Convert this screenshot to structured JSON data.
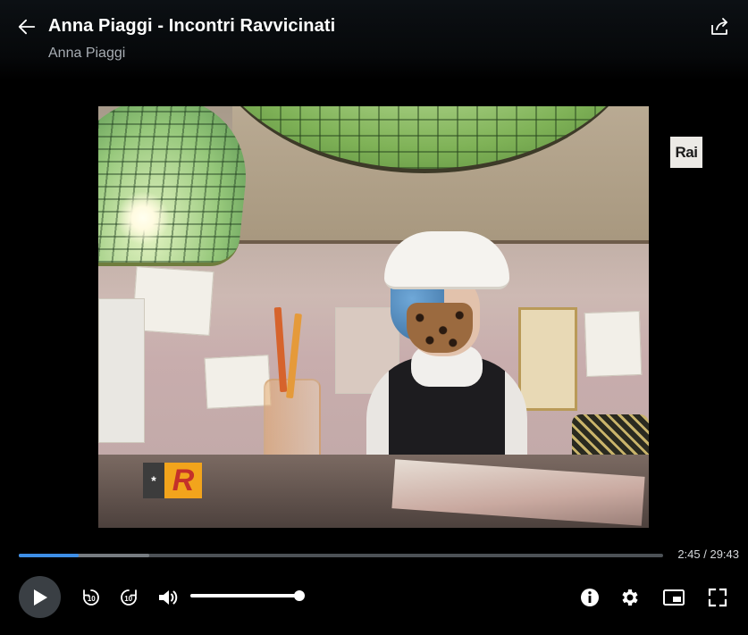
{
  "header": {
    "title": "Anna Piaggi - Incontri Ravvicinati",
    "subtitle": "Anna Piaggi"
  },
  "video": {
    "channel_logo": "Rai",
    "corner_logo_letter": "R",
    "corner_logo_mark": "*"
  },
  "playback": {
    "current_time": "2:45",
    "duration": "29:43",
    "time_display": "2:45 / 29:43",
    "played_fraction": 0.0925,
    "buffered_fraction": 0.203,
    "volume_fraction": 1.0
  },
  "colors": {
    "accent": "#3d8ee6",
    "background": "#000000"
  },
  "icons": {
    "back": "back-arrow-icon",
    "share": "share-icon",
    "play": "play-icon",
    "rewind": "rewind-10-icon",
    "forward": "forward-10-icon",
    "volume": "volume-icon",
    "info": "info-icon",
    "settings": "gear-icon",
    "pip": "picture-in-picture-icon",
    "fullscreen": "fullscreen-icon"
  }
}
